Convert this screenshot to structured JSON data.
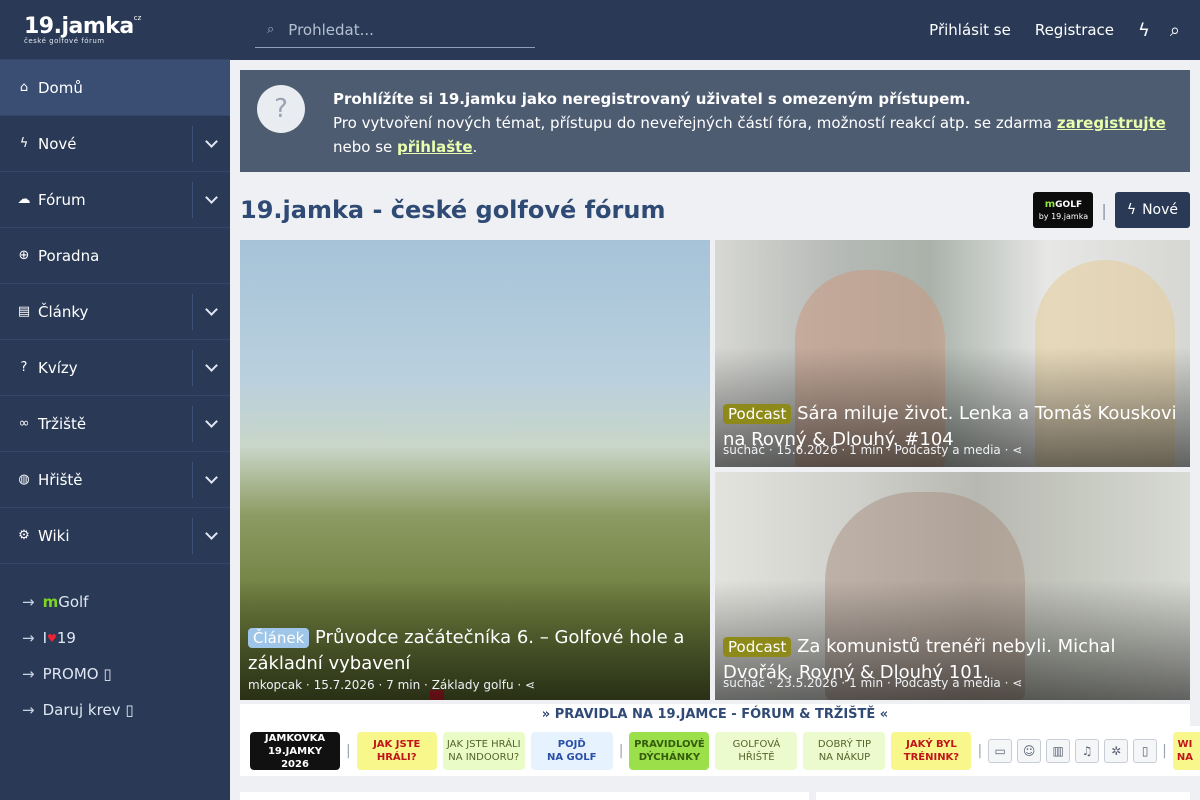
{
  "logo": {
    "text": "19.jamka",
    "cz": "cz",
    "sub": "české golfové fórum"
  },
  "search": {
    "placeholder": "Prohledat..."
  },
  "topbar": {
    "login": "Přihlásit se",
    "register": "Registrace"
  },
  "sidebar": {
    "items": [
      {
        "label": "Domů",
        "icon": "home-icon",
        "glyph": "⌂",
        "active": true,
        "toggle": false
      },
      {
        "label": "Nové",
        "icon": "bolt-icon",
        "glyph": "ϟ",
        "toggle": true
      },
      {
        "label": "Fórum",
        "icon": "comments-icon",
        "glyph": "☁",
        "toggle": true
      },
      {
        "label": "Poradna",
        "icon": "lifebuoy-icon",
        "glyph": "⊕",
        "toggle": false
      },
      {
        "label": "Články",
        "icon": "document-icon",
        "glyph": "▤",
        "toggle": true
      },
      {
        "label": "Kvízy",
        "icon": "question-icon",
        "glyph": "?",
        "toggle": true
      },
      {
        "label": "Tržiště",
        "icon": "handshake-icon",
        "glyph": "∞",
        "toggle": true
      },
      {
        "label": "Hřiště",
        "icon": "pin-icon",
        "glyph": "◍",
        "toggle": true
      },
      {
        "label": "Wiki",
        "icon": "gear-icon",
        "glyph": "⚙",
        "toggle": true
      }
    ],
    "sub_items": [
      {
        "prefix": "m",
        "label": "Golf"
      },
      {
        "prefix": "I",
        "heart": "♥",
        "label": "19"
      },
      {
        "label": "PROMO ▯"
      },
      {
        "label": "Daruj krev ▯"
      }
    ]
  },
  "notice": {
    "headline": "Prohlížíte si 19.jamku jako neregistrovaný uživatel s omezeným přístupem.",
    "text1": "Pro vytvoření nových témat, přístupu do neveřejných částí fóra, možností reakcí atp. se zdarma ",
    "link_register": "zaregistrujte",
    "text2": "nebo se ",
    "link_login": "přihlašte",
    "text3": "."
  },
  "page": {
    "title": "19.jamka - české golfové fórum",
    "mgolf_m": "m",
    "mgolf": "GOLF",
    "mgolf_by": "by 19.jamka",
    "separator": "|",
    "new_button": "Nové"
  },
  "cards": {
    "main": {
      "badge": "Článek",
      "title": "Průvodce začátečníka 6. – Golfové hole a základní vybavení",
      "author": "mkopcak",
      "date": "15.7.2026",
      "read": "7 min",
      "category": "Základy golfu"
    },
    "top": {
      "badge": "Podcast",
      "title": "Sára miluje život. Lenka a Tomáš Kouskovi na Rovný & Dlouhý. #104",
      "author": "sucháč",
      "date": "15.6.2026",
      "read": "1 min",
      "category": "Podcasty a media"
    },
    "bottom": {
      "badge": "Podcast",
      "title": "Za komunistů trenéři nebyli. Michal Dvořák. Rovný & Dlouhý 101.",
      "author": "sucháč",
      "date": "23.5.2026",
      "read": "1 min",
      "category": "Podcasty a media"
    },
    "meta_sep": "·",
    "share_glyph": "⋖"
  },
  "rules": "» PRAVIDLA NA 19.JAMCE - FÓRUM & TRŽIŠTĚ «",
  "shortcuts": {
    "jamkovka1": "JAMKOVKA",
    "jamkovka2": "19.JAMKY 2026",
    "jak_jste_hrali1": "JAK JSTE",
    "jak_jste_hrali2": "HRÁLI?",
    "indoor1": "JAK JSTE HRÁLI",
    "indoor2": "NA INDOORU?",
    "pojd1": "POJĎ",
    "pojd2": "NA GOLF",
    "dychanky1": "PRAVIDLOVÉ",
    "dychanky2": "DÝCHÁNKY",
    "hriste1": "GOLFOVÁ",
    "hriste2": "HŘIŠTĚ",
    "nakup1": "DOBRÝ TIP",
    "nakup2": "NA NÁKUP",
    "trenink1": "JAKÝ BYL",
    "trenink2": "TRÉNINK?",
    "wi1": "WI",
    "wi2": "NA",
    "separator": "|",
    "icons": [
      {
        "name": "tv-icon",
        "glyph": "▭"
      },
      {
        "name": "smile-icon",
        "glyph": "☺"
      },
      {
        "name": "book-icon",
        "glyph": "▥"
      },
      {
        "name": "music-icon",
        "glyph": "♫"
      },
      {
        "name": "brain-icon",
        "glyph": "✲"
      },
      {
        "name": "small-icon",
        "glyph": "▯"
      }
    ]
  }
}
